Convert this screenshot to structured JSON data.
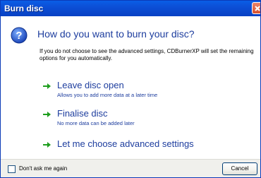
{
  "window": {
    "title": "Burn disc"
  },
  "header": {
    "icon": "question-icon",
    "question": "How do you want to burn your disc?",
    "description": "If you do not choose to see the advanced settings, CDBurnerXP will set the remaining options for you automatically."
  },
  "options": [
    {
      "icon": "green-arrow-icon",
      "title": "Leave disc open",
      "subtitle": "Allows you to add more data at a later time"
    },
    {
      "icon": "green-arrow-icon",
      "title": "Finalise disc",
      "subtitle": "No more data can be added later"
    },
    {
      "icon": "green-arrow-icon",
      "title": "Let me choose advanced settings",
      "subtitle": ""
    }
  ],
  "footer": {
    "checkbox_label": "Don't ask me again",
    "checkbox_checked": false,
    "cancel_label": "Cancel"
  },
  "colors": {
    "titlebar": "#0a5ee6",
    "link_text": "#1d3d9e",
    "arrow": "#1e9e1e",
    "close_button": "#d8502c"
  }
}
